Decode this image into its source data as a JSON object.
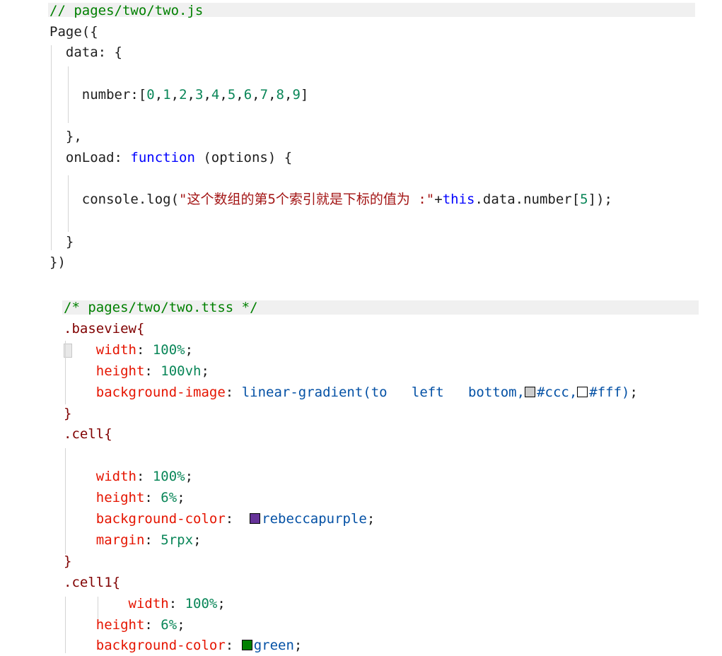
{
  "js_file": {
    "lines": [
      [
        {
          "t": "// pages/two/two.js",
          "c": "cmt"
        }
      ],
      [
        {
          "t": "Page({",
          "c": ""
        }
      ],
      [
        {
          "t": "  data: {",
          "c": ""
        }
      ],
      [
        {
          "t": "",
          "c": ""
        }
      ],
      [
        {
          "t": "    number:[",
          "c": ""
        },
        {
          "t": "0",
          "c": "num"
        },
        {
          "t": ",",
          "c": ""
        },
        {
          "t": "1",
          "c": "num"
        },
        {
          "t": ",",
          "c": ""
        },
        {
          "t": "2",
          "c": "num"
        },
        {
          "t": ",",
          "c": ""
        },
        {
          "t": "3",
          "c": "num"
        },
        {
          "t": ",",
          "c": ""
        },
        {
          "t": "4",
          "c": "num"
        },
        {
          "t": ",",
          "c": ""
        },
        {
          "t": "5",
          "c": "num"
        },
        {
          "t": ",",
          "c": ""
        },
        {
          "t": "6",
          "c": "num"
        },
        {
          "t": ",",
          "c": ""
        },
        {
          "t": "7",
          "c": "num"
        },
        {
          "t": ",",
          "c": ""
        },
        {
          "t": "8",
          "c": "num"
        },
        {
          "t": ",",
          "c": ""
        },
        {
          "t": "9",
          "c": "num"
        },
        {
          "t": "]",
          "c": ""
        }
      ],
      [
        {
          "t": "",
          "c": ""
        }
      ],
      [
        {
          "t": "  },",
          "c": ""
        }
      ],
      [
        {
          "t": "  onLoad: ",
          "c": ""
        },
        {
          "t": "function",
          "c": "kw"
        },
        {
          "t": " (options) {",
          "c": ""
        }
      ],
      [
        {
          "t": "",
          "c": ""
        }
      ],
      [
        {
          "t": "    console.log(",
          "c": ""
        },
        {
          "t": "\"这个数组的第5个索引就是下标的值为 :\"",
          "c": "str"
        },
        {
          "t": "+",
          "c": ""
        },
        {
          "t": "this",
          "c": "kw"
        },
        {
          "t": ".data.number[",
          "c": ""
        },
        {
          "t": "5",
          "c": "num"
        },
        {
          "t": "]);",
          "c": ""
        }
      ],
      [
        {
          "t": "",
          "c": ""
        }
      ],
      [
        {
          "t": "  }",
          "c": ""
        }
      ],
      [
        {
          "t": "})",
          "c": ""
        }
      ]
    ]
  },
  "css_file": {
    "lines": [
      [
        {
          "t": "/* pages/two/two.ttss */",
          "c": "cmt"
        }
      ],
      [
        {
          "t": ".baseview{",
          "c": "sel"
        }
      ],
      [
        {
          "t": "    ",
          "c": ""
        },
        {
          "t": "width",
          "c": "prop"
        },
        {
          "t": ": ",
          "c": ""
        },
        {
          "t": "100%",
          "c": "num"
        },
        {
          "t": ";",
          "c": ""
        }
      ],
      [
        {
          "t": "    ",
          "c": ""
        },
        {
          "t": "height",
          "c": "prop"
        },
        {
          "t": ": ",
          "c": ""
        },
        {
          "t": "100vh",
          "c": "num"
        },
        {
          "t": ";",
          "c": ""
        }
      ],
      [
        {
          "t": "    ",
          "c": ""
        },
        {
          "t": "background-image",
          "c": "prop"
        },
        {
          "t": ": ",
          "c": ""
        },
        {
          "t": "linear-gradient(to   left   bottom,",
          "c": "val"
        },
        {
          "sw": "#cccccc"
        },
        {
          "t": "#ccc,",
          "c": "val"
        },
        {
          "sw": "#ffffff"
        },
        {
          "t": "#fff)",
          "c": "val"
        },
        {
          "t": ";",
          "c": ""
        }
      ],
      [
        {
          "t": "}",
          "c": "sel"
        }
      ],
      [
        {
          "t": ".cell{",
          "c": "sel"
        }
      ],
      [
        {
          "t": "",
          "c": ""
        }
      ],
      [
        {
          "t": "    ",
          "c": ""
        },
        {
          "t": "width",
          "c": "prop"
        },
        {
          "t": ": ",
          "c": ""
        },
        {
          "t": "100%",
          "c": "num"
        },
        {
          "t": ";",
          "c": ""
        }
      ],
      [
        {
          "t": "    ",
          "c": ""
        },
        {
          "t": "height",
          "c": "prop"
        },
        {
          "t": ": ",
          "c": ""
        },
        {
          "t": "6%",
          "c": "num"
        },
        {
          "t": ";",
          "c": ""
        }
      ],
      [
        {
          "t": "    ",
          "c": ""
        },
        {
          "t": "background-color",
          "c": "prop"
        },
        {
          "t": ":  ",
          "c": ""
        },
        {
          "sw": "#663399"
        },
        {
          "t": "rebeccapurple",
          "c": "val"
        },
        {
          "t": ";",
          "c": ""
        }
      ],
      [
        {
          "t": "    ",
          "c": ""
        },
        {
          "t": "margin",
          "c": "prop"
        },
        {
          "t": ": ",
          "c": ""
        },
        {
          "t": "5rpx",
          "c": "num"
        },
        {
          "t": ";",
          "c": ""
        }
      ],
      [
        {
          "t": "}",
          "c": "sel"
        }
      ],
      [
        {
          "t": ".cell1{",
          "c": "sel"
        }
      ],
      [
        {
          "t": "        ",
          "c": ""
        },
        {
          "t": "width",
          "c": "prop"
        },
        {
          "t": ": ",
          "c": ""
        },
        {
          "t": "100%",
          "c": "num"
        },
        {
          "t": ";",
          "c": ""
        }
      ],
      [
        {
          "t": "    ",
          "c": ""
        },
        {
          "t": "height",
          "c": "prop"
        },
        {
          "t": ": ",
          "c": ""
        },
        {
          "t": "6%",
          "c": "num"
        },
        {
          "t": ";",
          "c": ""
        }
      ],
      [
        {
          "t": "    ",
          "c": ""
        },
        {
          "t": "background-color",
          "c": "prop"
        },
        {
          "t": ": ",
          "c": ""
        },
        {
          "sw": "#008000"
        },
        {
          "t": "green",
          "c": "val"
        },
        {
          "t": ";",
          "c": ""
        }
      ]
    ]
  },
  "colors": {
    "comment": "#008000",
    "keyword": "#0000ff",
    "string": "#a31515",
    "number": "#098658",
    "selector": "#800000",
    "property": "#e51400",
    "value": "#0451a5"
  }
}
